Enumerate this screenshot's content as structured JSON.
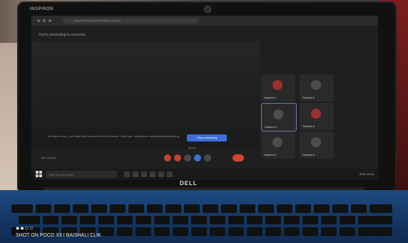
{
  "laptop": {
    "brand_top": "INSPIRON",
    "brand_bezel": "DELL"
  },
  "browser": {
    "url": "https://meet.google.com/abc-defg-hij"
  },
  "meet": {
    "header": "You're presenting to everyone",
    "notice": "To reduce echo, your other tab's audio will not be shared. Keep your microphone muted while presenting.",
    "stop_button": "Stop presenting",
    "ignore_label": "Ignore",
    "meeting_code": "abc-defg-hij",
    "tiles": [
      {
        "name": "Student 1"
      },
      {
        "name": "Student 2"
      },
      {
        "name": "Student 3"
      },
      {
        "name": "Student 4"
      },
      {
        "name": "Student 5"
      },
      {
        "name": "Student 6"
      }
    ]
  },
  "taskbar": {
    "search_placeholder": "Type here to search",
    "tray_text": "ENG 10:45"
  },
  "watermark": {
    "dots": "●●○○",
    "text": "SHOT ON POCO X3 I BAISHALI CLIK"
  }
}
